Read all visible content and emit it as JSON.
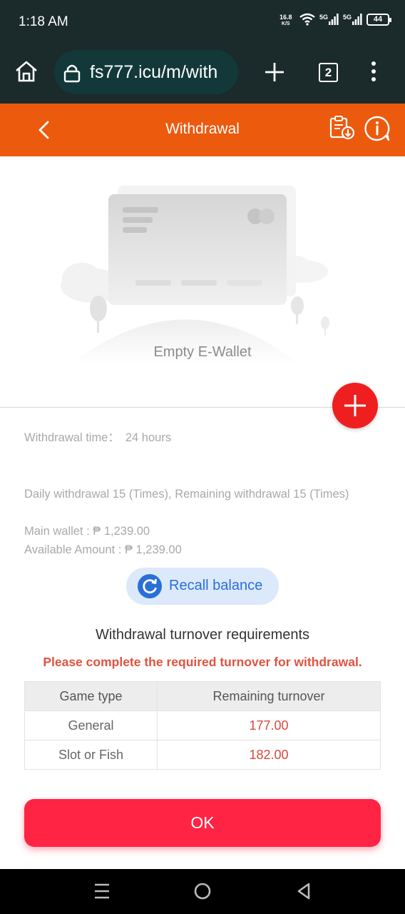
{
  "status": {
    "time": "1:18 AM",
    "net_speed": "16.8",
    "net_unit": "K/S",
    "sig1": "5G",
    "sig2": "5G",
    "battery": "44"
  },
  "browser": {
    "url": "fs777.icu/m/with",
    "tab_count": "2"
  },
  "header": {
    "title": "Withdrawal"
  },
  "wallet": {
    "empty_label": "Empty E-Wallet"
  },
  "info": {
    "withdraw_time_label": "Withdrawal time：",
    "withdraw_time_value": "24 hours",
    "daily_limit": "Daily withdrawal 15 (Times), Remaining withdrawal 15 (Times)",
    "main_wallet": "Main wallet : ₱ 1,239.00",
    "available": "Available Amount : ₱ 1,239.00"
  },
  "recall": {
    "label": "Recall balance"
  },
  "turnover": {
    "title": "Withdrawal turnover requirements",
    "warning": "Please complete the required turnover for withdrawal.",
    "headers": [
      "Game type",
      "Remaining turnover"
    ],
    "rows": [
      {
        "type": "General",
        "amount": "177.00"
      },
      {
        "type": "Slot or Fish",
        "amount": "182.00"
      }
    ]
  },
  "ok_label": "OK",
  "colors": {
    "header": "#ec5a0e",
    "ok": "#ff2344",
    "accent_blue": "#2a6fd6",
    "warning": "#e0533f"
  }
}
